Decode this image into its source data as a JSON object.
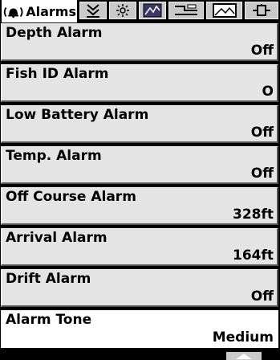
{
  "tabs": [
    {
      "label": "Alarms",
      "icon": "alarm-bell-icon",
      "active": true
    },
    {
      "icon": "sonar-icon",
      "active": false
    },
    {
      "icon": "setup-gear-icon",
      "active": false
    },
    {
      "icon": "navigation-map-icon",
      "active": false
    },
    {
      "icon": "chart-settings-icon",
      "active": false
    },
    {
      "icon": "landscape-view-icon",
      "active": false
    },
    {
      "icon": "accessories-icon",
      "active": false
    }
  ],
  "menu": {
    "items": [
      {
        "label": "Depth Alarm",
        "value": "Off"
      },
      {
        "label": "Fish ID Alarm",
        "value": "O"
      },
      {
        "label": "Low Battery Alarm",
        "value": "Off"
      },
      {
        "label": "Temp. Alarm",
        "value": "Off"
      },
      {
        "label": "Off Course Alarm",
        "value": "328ft"
      },
      {
        "label": "Arrival Alarm",
        "value": "164ft"
      },
      {
        "label": "Drift Alarm",
        "value": "Off"
      },
      {
        "label": "Alarm Tone",
        "value": "Medium"
      }
    ]
  },
  "scroll": {
    "icon": "scroll-up-arrow-icon"
  }
}
